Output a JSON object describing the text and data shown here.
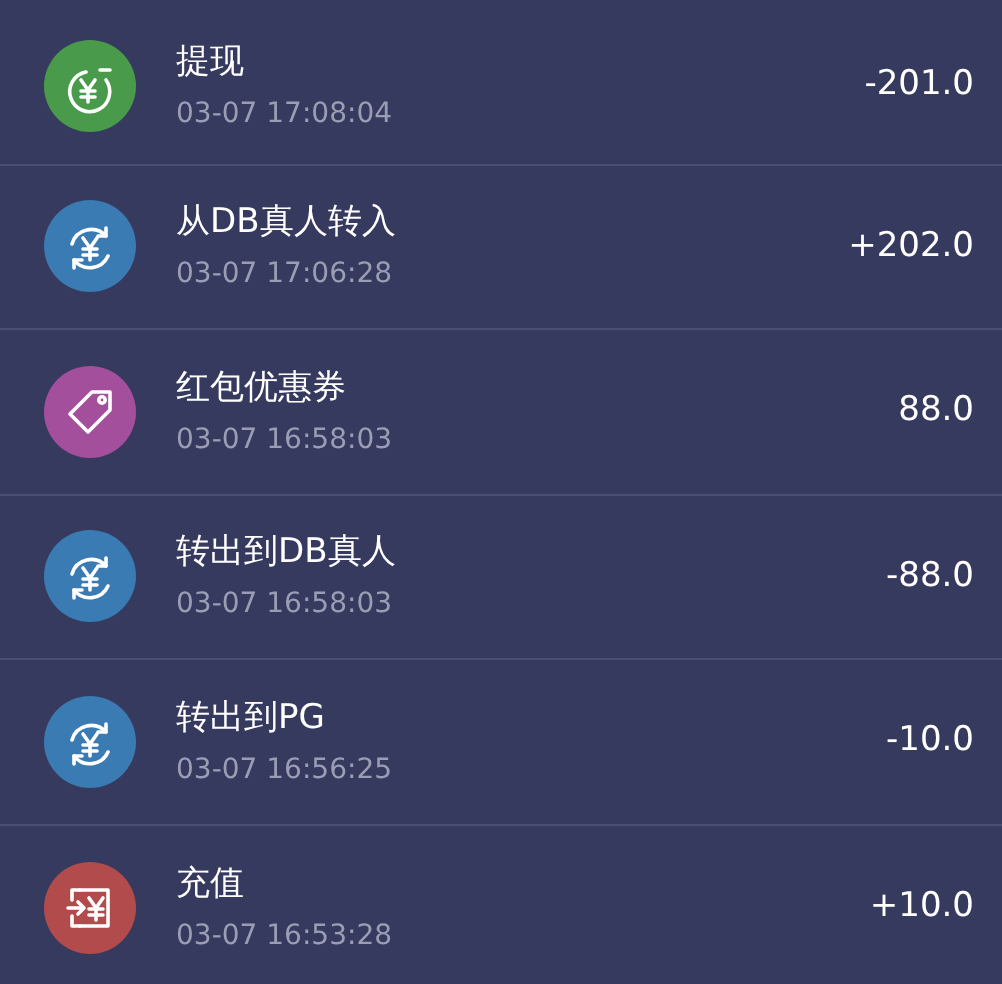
{
  "transactions": [
    {
      "kind": "withdraw",
      "title": "提现",
      "time": "03-07 17:08:04",
      "amount": "-201.0"
    },
    {
      "kind": "transfer",
      "title": "从DB真人转入",
      "time": "03-07 17:06:28",
      "amount": "+202.0"
    },
    {
      "kind": "coupon",
      "title": "红包优惠券",
      "time": "03-07 16:58:03",
      "amount": "88.0"
    },
    {
      "kind": "transfer",
      "title": "转出到DB真人",
      "time": "03-07 16:58:03",
      "amount": "-88.0"
    },
    {
      "kind": "transfer",
      "title": "转出到PG",
      "time": "03-07 16:56:25",
      "amount": "-10.0"
    },
    {
      "kind": "deposit",
      "title": "充值",
      "time": "03-07 16:53:28",
      "amount": "+10.0"
    }
  ]
}
